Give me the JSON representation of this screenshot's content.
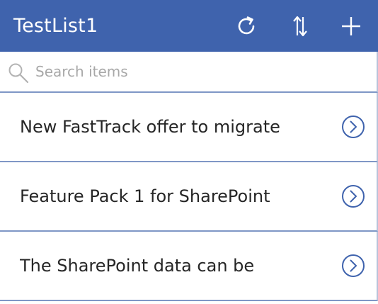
{
  "header": {
    "title": "TestList1",
    "background_color": "#3f63ad",
    "buttons": [
      {
        "name": "refresh-icon"
      },
      {
        "name": "sort-icon"
      },
      {
        "name": "add-icon"
      }
    ]
  },
  "search": {
    "placeholder": "Search items",
    "value": "",
    "icon": "search-icon"
  },
  "items": [
    {
      "label": "New FastTrack offer to migrate",
      "icon": "chevron-right-circle-icon"
    },
    {
      "label": "Feature Pack 1 for SharePoint",
      "icon": "chevron-right-circle-icon"
    },
    {
      "label": "The SharePoint data can be",
      "icon": "chevron-right-circle-icon"
    }
  ],
  "colors": {
    "accent": "#3f63ad",
    "divider": "#7f97c6",
    "text": "#262626",
    "placeholder": "#a8a8a8"
  }
}
